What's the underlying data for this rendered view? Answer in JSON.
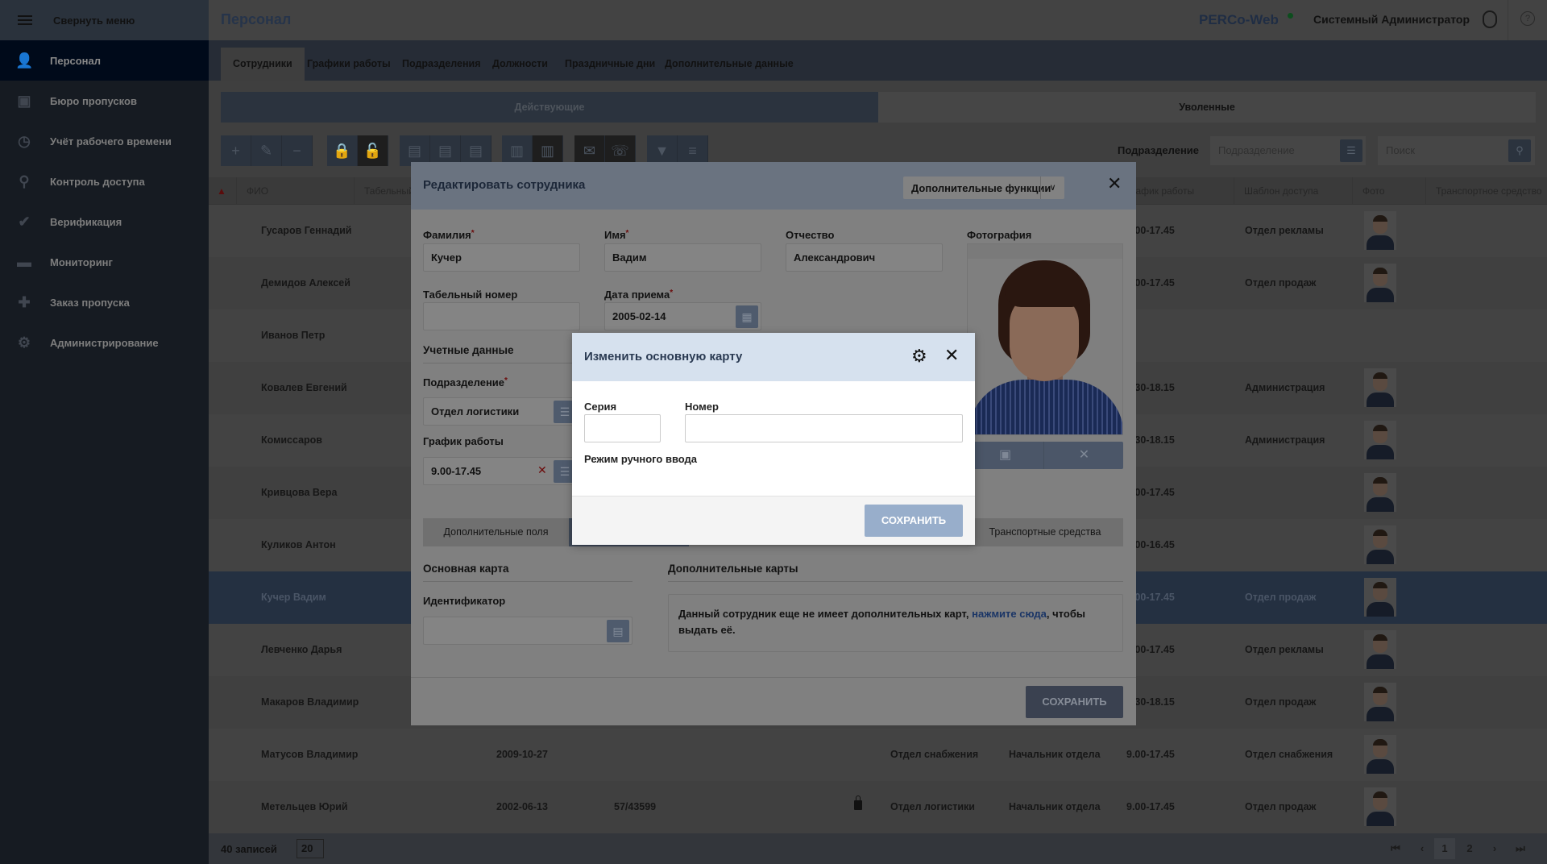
{
  "sidebar": {
    "collapse_label": "Свернуть меню",
    "items": [
      {
        "label": "Персонал",
        "icon": "people-icon",
        "glyph": "👤",
        "active": true
      },
      {
        "label": "Бюро пропусков",
        "icon": "badge-icon",
        "glyph": "▣"
      },
      {
        "label": "Учёт рабочего времени",
        "icon": "clock-person-icon",
        "glyph": "◷"
      },
      {
        "label": "Контроль доступа",
        "icon": "key-icon",
        "glyph": "⚲"
      },
      {
        "label": "Верификация",
        "icon": "verify-icon",
        "glyph": "✔"
      },
      {
        "label": "Мониторинг",
        "icon": "monitor-chat-icon",
        "glyph": "▬"
      },
      {
        "label": "Заказ пропуска",
        "icon": "order-pass-icon",
        "glyph": "✚"
      },
      {
        "label": "Администрирование",
        "icon": "gear-icon",
        "glyph": "⚙"
      }
    ]
  },
  "header": {
    "title": "Персонал",
    "brand": "PERCo-Web",
    "user": "Системный Администратор",
    "help": "?"
  },
  "tabs": [
    "Сотрудники",
    "Графики работы",
    "Подразделения",
    "Должности",
    "Праздничные дни",
    "Дополнительные данные"
  ],
  "segments": {
    "active": "Действующие",
    "fired": "Уволенные"
  },
  "toolbar": {
    "buttons": [
      {
        "name": "add",
        "glyph": "+"
      },
      {
        "name": "edit",
        "glyph": "✎"
      },
      {
        "name": "delete",
        "glyph": "−"
      },
      {
        "name": "lock",
        "glyph": "🔒"
      },
      {
        "name": "unlock",
        "glyph": "🔓"
      },
      {
        "name": "card",
        "glyph": "▤"
      },
      {
        "name": "card-remove",
        "glyph": "▤"
      },
      {
        "name": "card-search",
        "glyph": "▤"
      },
      {
        "name": "barcode",
        "glyph": "▥"
      },
      {
        "name": "barcode-remove",
        "glyph": "▥"
      },
      {
        "name": "mail",
        "glyph": "✉"
      },
      {
        "name": "viber",
        "glyph": "☏"
      },
      {
        "name": "filter",
        "glyph": "▼"
      },
      {
        "name": "columns",
        "glyph": "≡"
      }
    ],
    "filter_label": "Подразделение",
    "filter_placeholder": "Подразделение",
    "search_placeholder": "Поиск"
  },
  "table": {
    "columns": [
      "ФИО",
      "Табельный номер",
      "График работы",
      "Шаблон доступа",
      "Фото",
      "Транспортное средство"
    ],
    "rows": [
      {
        "name": "Гусаров Геннадий",
        "date": "",
        "tab": "",
        "locked": false,
        "dept": "",
        "pos": "",
        "schedule": "9.00-17.45",
        "template": "Отдел рекламы",
        "photo": true
      },
      {
        "name": "Демидов Алексей",
        "date": "",
        "tab": "",
        "locked": false,
        "dept": "",
        "pos": "",
        "schedule": "9.00-17.45",
        "template": "Отдел продаж",
        "photo": true
      },
      {
        "name": "Иванов Петр",
        "date": "",
        "tab": "",
        "locked": false,
        "dept": "",
        "pos": "",
        "schedule": "",
        "template": "",
        "photo": false
      },
      {
        "name": "Ковалев Евгений",
        "date": "",
        "tab": "",
        "locked": false,
        "dept": "",
        "pos": "",
        "schedule": "8.30-18.15",
        "template": "Администрация",
        "photo": true
      },
      {
        "name": "Комиссаров",
        "date": "",
        "tab": "",
        "locked": false,
        "dept": "",
        "pos": "",
        "schedule": "8.30-18.15",
        "template": "Администрация",
        "photo": true
      },
      {
        "name": "Кривцова Вера",
        "date": "",
        "tab": "",
        "locked": false,
        "dept": "",
        "pos": "",
        "schedule": "9.00-17.45",
        "template": "",
        "photo": true
      },
      {
        "name": "Куликов Антон",
        "date": "",
        "tab": "",
        "locked": false,
        "dept": "",
        "pos": "",
        "schedule": "9.00-16.45",
        "template": "",
        "photo": true
      },
      {
        "name": "Кучер Вадим",
        "date": "",
        "tab": "",
        "locked": false,
        "dept": "",
        "pos": "",
        "schedule": "9.00-17.45",
        "template": "Отдел продаж",
        "photo": true,
        "selected": true
      },
      {
        "name": "Левченко Дарья",
        "date": "",
        "tab": "",
        "locked": false,
        "dept": "",
        "pos": "",
        "schedule": "9.00-17.45",
        "template": "Отдел рекламы",
        "photo": true
      },
      {
        "name": "Макаров Владимир",
        "date": "",
        "tab": "",
        "locked": false,
        "dept": "",
        "pos": "",
        "schedule": "8.30-18.15",
        "template": "Отдел продаж",
        "photo": true
      },
      {
        "name": "Матусов Владимир",
        "date": "2009-10-27",
        "tab": "",
        "locked": false,
        "dept": "Отдел снабжения",
        "pos": "Начальник отдела",
        "schedule": "9.00-17.45",
        "template": "Отдел снабжения",
        "photo": true
      },
      {
        "name": "Метельцев Юрий",
        "date": "2002-06-13",
        "tab": "57/43599",
        "locked": true,
        "dept": "Отдел логистики",
        "pos": "Начальник отдела",
        "schedule": "9.00-17.45",
        "template": "Отдел продаж",
        "photo": true
      }
    ]
  },
  "footer": {
    "count": "40 записей",
    "page_size": "20",
    "pages": [
      "1",
      "2"
    ],
    "current_page": "1"
  },
  "edit_modal": {
    "title": "Редактировать сотрудника",
    "more_label": "Дополнительные функции",
    "last_name_label": "Фамилия",
    "last_name": "Кучер",
    "first_name_label": "Имя",
    "first_name": "Вадим",
    "middle_name_label": "Отчество",
    "middle_name": "Александрович",
    "photo_label": "Фотография",
    "tab_number_label": "Табельный номер",
    "tab_number": "",
    "hire_date_label": "Дата приема",
    "hire_date": "2005-02-14",
    "account_section": "Учетные данные",
    "division_label": "Подразделение",
    "division": "Отдел логистики",
    "schedule_label": "График работы",
    "schedule": "9.00-17.45",
    "tab_extra_fields": "Дополнительные поля",
    "tab_vehicles": "Транспортные средства",
    "main_card_section": "Основная карта",
    "extra_cards_section": "Дополнительные карты",
    "identifier_label": "Идентификатор",
    "identifier": "",
    "info_text": "Данный сотрудник еще не имеет дополнительных карт, ",
    "info_link": "нажмите сюда",
    "info_text_end": ", чтобы выдать её.",
    "save_label": "СОХРАНИТЬ"
  },
  "card_modal": {
    "title": "Изменить основную карту",
    "series_label": "Серия",
    "series": "",
    "number_label": "Номер",
    "number": "",
    "manual_mode": "Режим ручного ввода",
    "save_label": "СОХРАНИТЬ"
  }
}
